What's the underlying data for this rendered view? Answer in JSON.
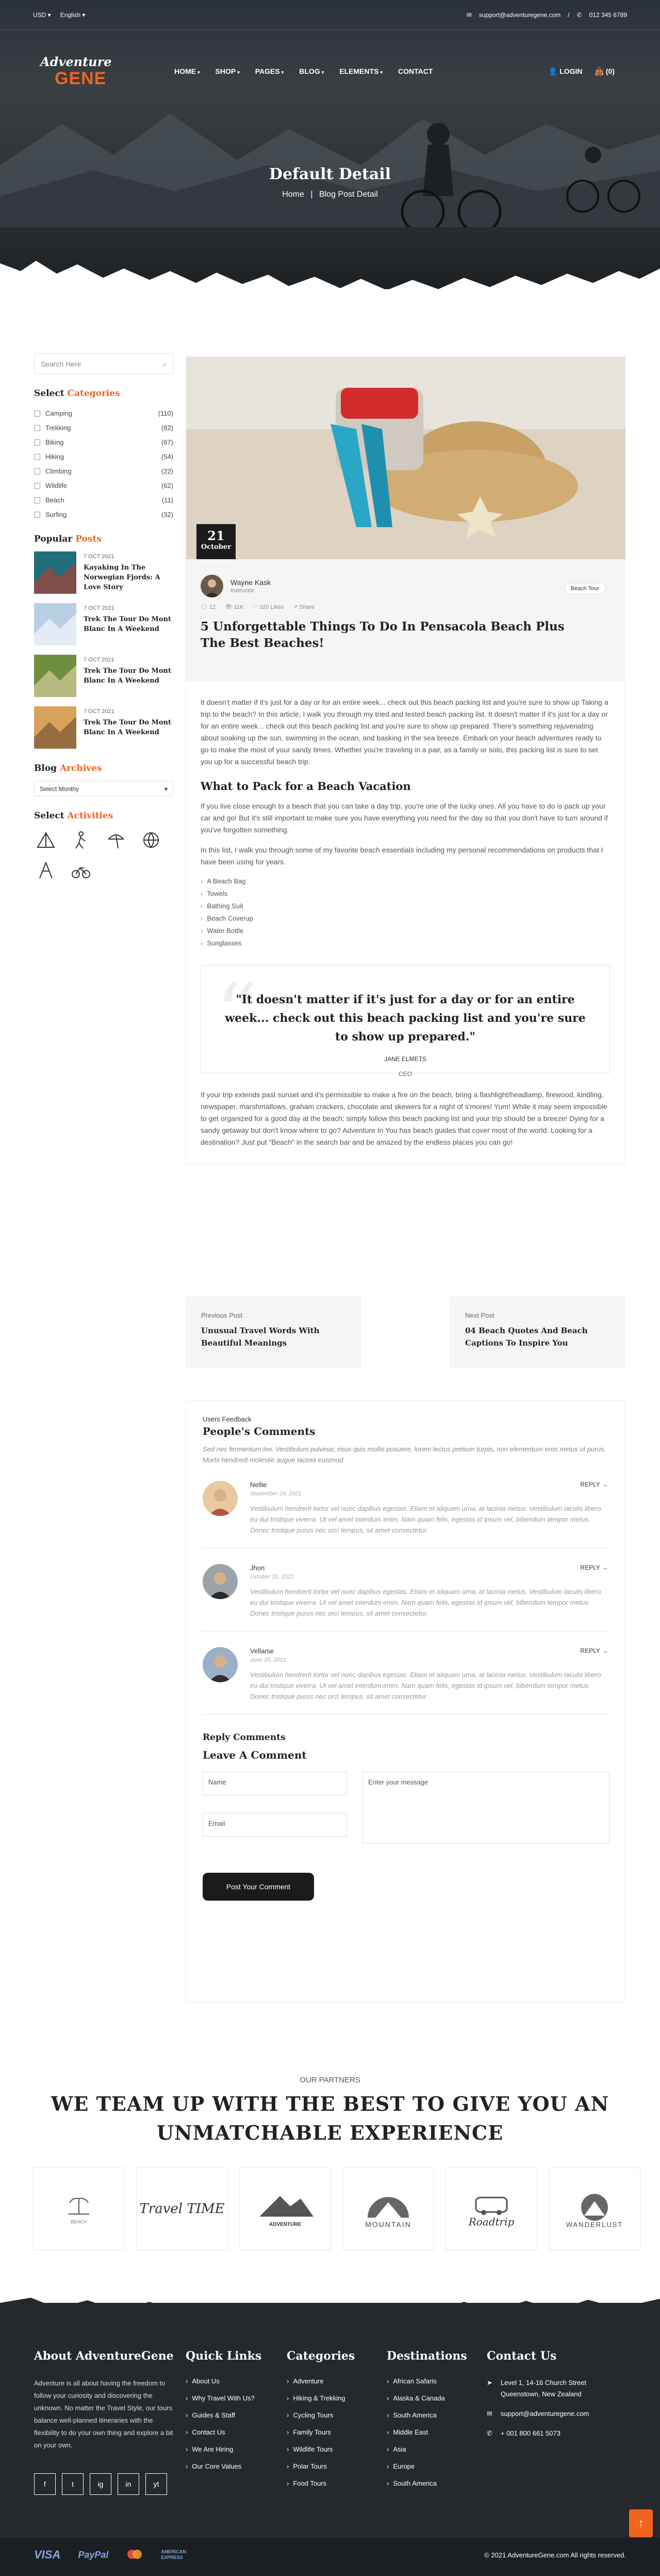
{
  "topbar": {
    "currency": "USD",
    "language": "English",
    "email": "support@adventuregene.com",
    "phone": "012 345 6789"
  },
  "logo": {
    "line1": "Adventure",
    "line2": "GENE"
  },
  "nav": {
    "items": [
      "HOME",
      "SHOP",
      "PAGES",
      "BLOG",
      "ELEMENTS",
      "CONTACT"
    ],
    "login": "LOGIN",
    "cart": "(0)"
  },
  "hero": {
    "title": "Default Detail",
    "crumb_home": "Home",
    "crumb_sep": "|",
    "crumb_current": "Blog Post Detail"
  },
  "sidebar": {
    "search_placeholder": "Search Here",
    "categories_title_a": "Select ",
    "categories_title_b": "Categories",
    "categories": [
      {
        "name": "Camping",
        "count": "(110)"
      },
      {
        "name": "Trekking",
        "count": "(82)"
      },
      {
        "name": "Biking",
        "count": "(67)"
      },
      {
        "name": "Hiking",
        "count": "(54)"
      },
      {
        "name": "Climbing",
        "count": "(22)"
      },
      {
        "name": "Wildlife",
        "count": "(62)"
      },
      {
        "name": "Beach",
        "count": "(11)"
      },
      {
        "name": "Surfing",
        "count": "(32)"
      }
    ],
    "popular_title_a": "Popular ",
    "popular_title_b": "Posts",
    "posts": [
      {
        "date": "7 OCT 2021",
        "title": "Kayaking In The Norwegian Fjords: A Love Story"
      },
      {
        "date": "7 OCT 2021",
        "title": "Trek The Tour Do Mont Blanc In A Weekend"
      },
      {
        "date": "7 OCT 2021",
        "title": "Trek The Tour Do Mont Blanc In A Weekend"
      },
      {
        "date": "7 OCT 2021",
        "title": "Trek The Tour Do Mont Blanc In A Weekend"
      }
    ],
    "archives_title_a": "Blog ",
    "archives_title_b": "Archives",
    "archive_select": "Select Monthy",
    "activities_title_a": "Select ",
    "activities_title_b": "Activities"
  },
  "post": {
    "day": "21",
    "month": "October",
    "author": "Wayne Kask",
    "role": "Instructor",
    "tag": "Beach Tour",
    "comments": "12",
    "views": "11K",
    "likes": "320 Likes",
    "share": "Share",
    "title": "5 Unforgettable Things To Do In Pensacola Beach Plus The Best Beaches!",
    "p1": "It doesn't matter if it's just for a day or for an entire week... check out this beach packing list and you're sure to show up Taking a trip to the beach? In this article, I walk you through my tried and tested beach packing list. It doesn't matter if it's just for a day or for an entire week... check out this beach packing list and you're sure to show up prepared. There's something rejuvenating about soaking up the sun, swimming in the ocean, and basking in the sea breeze. Embark on your beach adventures ready to go to make the most of your sandy times. Whether you're traveling in a pair, as a family or solo, this packing list is sure to set you up for a successful beach trip.",
    "h3": "What to Pack for a Beach Vacation",
    "p2": "If you live close enough to a beach that you can take a day trip, you're one of the lucky ones. All you have to do is pack up your car and go! But it's still important to make sure you have everything you need for the day so that you don't have to turn around if you've forgotten something.",
    "p3": "In this list, I walk you through some of my favorite beach essentials including my personal recommendations on products that I have been using for years.",
    "list": [
      "A Beach Bag",
      "Towels",
      "Bathing Suit",
      "Beach Coverup",
      "Water Bottle",
      "Sunglasses"
    ],
    "quote": "\"It doesn't matter if it's just for a day or for an entire week... check out this beach packing list and you're sure to show up prepared.\"",
    "quote_name": "JANE ELMETS",
    "quote_role": "CEO",
    "p4": "If your trip extends past sunset and it's permissible to make a fire on the beach, bring a flashlight/headlamp, firewood, kindling, newspaper, marshmallows, graham crackers, chocolate and skewers for a night of s'mores! Yum! While it may seem impossible to get organized for a good day at the beach; simply follow this beach packing list and your trip should be a breeze! Dying for a sandy getaway but don't know where to go? Adventure In You has beach guides that cover most of the world. Looking for a destination? Just put \"Beach\" in the search bar and be amazed by the endless places you can go!"
  },
  "postnav": {
    "prev_label": "Previous Post",
    "prev_title": "Unusual Travel Words With Beautiful Meanings",
    "next_label": "Next Post",
    "next_title": "04 Beach Quotes And Beach Captions To Inspire You"
  },
  "comments": {
    "feedback": "Users Feedback",
    "title": "People's Comments",
    "intro": "Sed nec fermentum leo. Vestibulum pulvinar, risus quis mollis posuere, lorem lectus pretium turpis, non elementum eros metus ut purus. Morbi hendrerit molestie augue lacinia euismod",
    "reply": "REPLY →",
    "items": [
      {
        "name": "Nellie",
        "date": "September 20, 2021",
        "text": "Vestibulum hendrerit tortor vel nunc dapibus egestas. Etiam et aliquam urna, at lacinia metus. Vestibulum iaculis libero eu dui tristique viverra. Ut vel amet interdum enim. Nam quam felis, egestas id ipsum vel, bibendum tempor metus. Donec tristique purus nec orci tempus, sit amet consectetur."
      },
      {
        "name": "Jhon",
        "date": "October 20, 2021",
        "text": "Vestibulum hendrerit tortor vel nunc dapibus egestas. Etiam et aliquam urna, at lacinia metus. Vestibulum iaculis libero eu dui tristique viverra. Ut vel amet interdum enim. Nam quam felis, egestas id ipsum vel, bibendum tempor metus. Donec tristique purus nec orci tempus, sit amet consectetur."
      },
      {
        "name": "Vellarse",
        "date": "June 20, 2021",
        "text": "Vestibulum hendrerit tortor vel nunc dapibus egestas. Etiam et aliquam urna, at lacinia metus. Vestibulum iaculis libero eu dui tristique viverra. Ut vel amet interdum enim. Nam quam felis, egestas id ipsum vel, bibendum tempor metus. Donec tristique purus nec orci tempus, sit amet consectetur."
      }
    ],
    "reply_title": "Reply Comments",
    "leave_title": "Leave A Comment",
    "name_ph": "Name",
    "email_ph": "Email",
    "msg_ph": "Enter your message",
    "submit": "Post Your Comment"
  },
  "partners": {
    "our": "OUR PARTNERS",
    "title_l1": "WE TEAM UP WITH THE BEST TO GIVE YOU AN",
    "title_l2": "UNMATCHABLE EXPERIENCE",
    "logos": [
      "BEACH",
      "Travel TIME",
      "ADVENTURE",
      "MOUNTAIN",
      "Roadtrip",
      "WANDERLUST"
    ]
  },
  "footer": {
    "about_title": "About AdventureGene",
    "about_text": "Adventure is all about having the freedom to follow your curiosity and discovering the unknown. No matter the Travel Style, our tours balance well-planned itineraries with the flexibility to do your own thing and explore a bit on your own.",
    "quick_title": "Quick Links",
    "quick": [
      "About Us",
      "Why Travel With Us?",
      "Guides & Staff",
      "Contact Us",
      "We Are Hiring",
      "Our Core Values"
    ],
    "cat_title": "Categories",
    "cats": [
      "Adventure",
      "Hiking & Trekking",
      "Cycling Tours",
      "Family Tours",
      "Wildlife Tours",
      "Polar Tours",
      "Food Tours"
    ],
    "dest_title": "Destinations",
    "dests": [
      "African Safaris",
      "Alaska & Canada",
      "South America",
      "Middle East",
      "Asia",
      "Europe",
      "South America"
    ],
    "contact_title": "Contact Us",
    "address": "Level 1, 14-16 Church Street Queenstown, New Zealand",
    "email": "support@adventuregene.com",
    "phone": "+ 001 800 661 5073",
    "socials": [
      "f",
      "t",
      "ig",
      "in",
      "yt"
    ],
    "pays": [
      "VISA",
      "PayPal",
      "mc",
      "AMERICAN EXPRESS"
    ],
    "copyright": "© 2021 AdventureGene.com All rights reserved."
  },
  "colors": {
    "accent": "#f2641e",
    "dark": "#1b1b1b",
    "footer": "#25292d"
  }
}
